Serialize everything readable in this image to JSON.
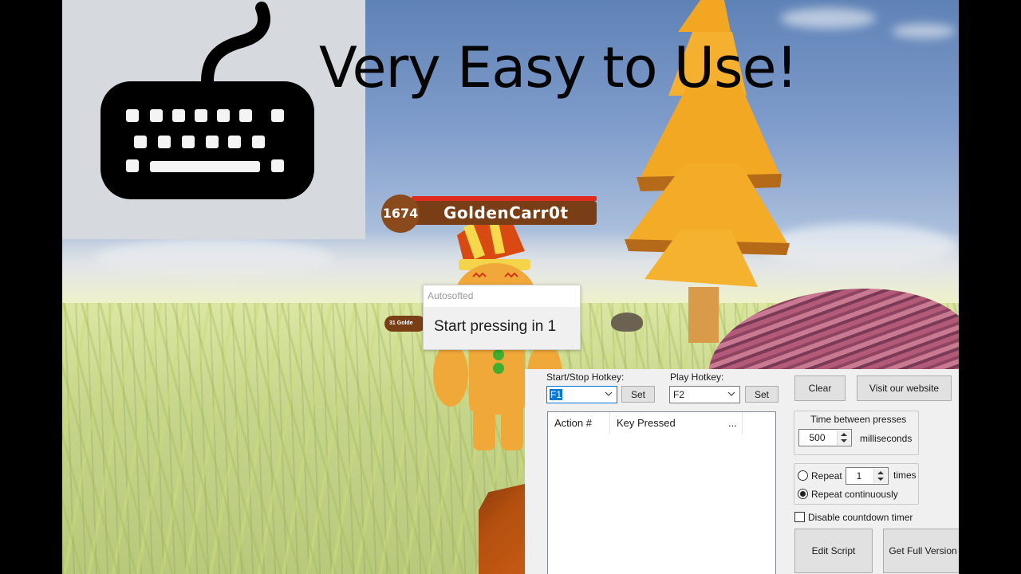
{
  "video_overlay": {
    "headline": "Very Easy to Use!",
    "keyboard_icon": "keyboard-icon"
  },
  "game": {
    "player": {
      "level": "1674",
      "name": "GoldenCarr0t"
    },
    "other_player": {
      "level": "31",
      "name": "Golde"
    }
  },
  "countdown_popup": {
    "title": "Autosofted",
    "message": "Start pressing in 1"
  },
  "app": {
    "start_stop_hotkey": {
      "label": "Start/Stop Hotkey:",
      "value": "F1",
      "set_label": "Set"
    },
    "play_hotkey": {
      "label": "Play Hotkey:",
      "value": "F2",
      "set_label": "Set"
    },
    "buttons": {
      "clear": "Clear",
      "visit_website": "Visit our website",
      "edit_script": "Edit Script",
      "get_full_version": "Get Full Version"
    },
    "list": {
      "columns": [
        "Action #",
        "Key Pressed",
        "..."
      ],
      "rows": []
    },
    "timing": {
      "group_label": "Time between presses",
      "value": "500",
      "unit": "milliseconds"
    },
    "repeat": {
      "repeat_label": "Repeat",
      "repeat_count": "1",
      "times_label": "times",
      "continuous_label": "Repeat continuously",
      "selected": "continuous"
    },
    "disable_countdown": {
      "label": "Disable countdown timer",
      "checked": false
    }
  },
  "colors": {
    "accent": "#0078d7",
    "panel_bg": "#f0f0f0",
    "nameplate_brown": "#7a3e16",
    "health_red": "#e02b20"
  }
}
